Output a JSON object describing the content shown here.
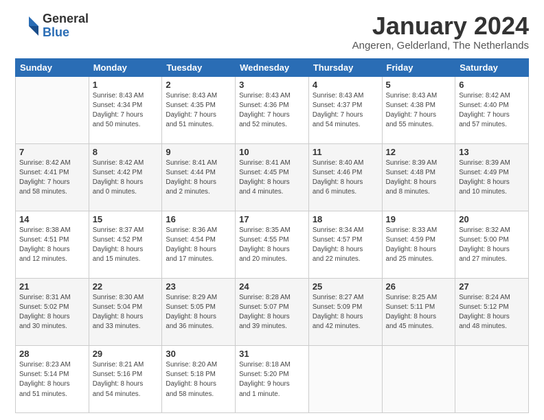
{
  "logo": {
    "general": "General",
    "blue": "Blue"
  },
  "title": "January 2024",
  "subtitle": "Angeren, Gelderland, The Netherlands",
  "days_header": [
    "Sunday",
    "Monday",
    "Tuesday",
    "Wednesday",
    "Thursday",
    "Friday",
    "Saturday"
  ],
  "weeks": [
    [
      {
        "day": "",
        "info": ""
      },
      {
        "day": "1",
        "info": "Sunrise: 8:43 AM\nSunset: 4:34 PM\nDaylight: 7 hours\nand 50 minutes."
      },
      {
        "day": "2",
        "info": "Sunrise: 8:43 AM\nSunset: 4:35 PM\nDaylight: 7 hours\nand 51 minutes."
      },
      {
        "day": "3",
        "info": "Sunrise: 8:43 AM\nSunset: 4:36 PM\nDaylight: 7 hours\nand 52 minutes."
      },
      {
        "day": "4",
        "info": "Sunrise: 8:43 AM\nSunset: 4:37 PM\nDaylight: 7 hours\nand 54 minutes."
      },
      {
        "day": "5",
        "info": "Sunrise: 8:43 AM\nSunset: 4:38 PM\nDaylight: 7 hours\nand 55 minutes."
      },
      {
        "day": "6",
        "info": "Sunrise: 8:42 AM\nSunset: 4:40 PM\nDaylight: 7 hours\nand 57 minutes."
      }
    ],
    [
      {
        "day": "7",
        "info": "Sunrise: 8:42 AM\nSunset: 4:41 PM\nDaylight: 7 hours\nand 58 minutes."
      },
      {
        "day": "8",
        "info": "Sunrise: 8:42 AM\nSunset: 4:42 PM\nDaylight: 8 hours\nand 0 minutes."
      },
      {
        "day": "9",
        "info": "Sunrise: 8:41 AM\nSunset: 4:44 PM\nDaylight: 8 hours\nand 2 minutes."
      },
      {
        "day": "10",
        "info": "Sunrise: 8:41 AM\nSunset: 4:45 PM\nDaylight: 8 hours\nand 4 minutes."
      },
      {
        "day": "11",
        "info": "Sunrise: 8:40 AM\nSunset: 4:46 PM\nDaylight: 8 hours\nand 6 minutes."
      },
      {
        "day": "12",
        "info": "Sunrise: 8:39 AM\nSunset: 4:48 PM\nDaylight: 8 hours\nand 8 minutes."
      },
      {
        "day": "13",
        "info": "Sunrise: 8:39 AM\nSunset: 4:49 PM\nDaylight: 8 hours\nand 10 minutes."
      }
    ],
    [
      {
        "day": "14",
        "info": "Sunrise: 8:38 AM\nSunset: 4:51 PM\nDaylight: 8 hours\nand 12 minutes."
      },
      {
        "day": "15",
        "info": "Sunrise: 8:37 AM\nSunset: 4:52 PM\nDaylight: 8 hours\nand 15 minutes."
      },
      {
        "day": "16",
        "info": "Sunrise: 8:36 AM\nSunset: 4:54 PM\nDaylight: 8 hours\nand 17 minutes."
      },
      {
        "day": "17",
        "info": "Sunrise: 8:35 AM\nSunset: 4:55 PM\nDaylight: 8 hours\nand 20 minutes."
      },
      {
        "day": "18",
        "info": "Sunrise: 8:34 AM\nSunset: 4:57 PM\nDaylight: 8 hours\nand 22 minutes."
      },
      {
        "day": "19",
        "info": "Sunrise: 8:33 AM\nSunset: 4:59 PM\nDaylight: 8 hours\nand 25 minutes."
      },
      {
        "day": "20",
        "info": "Sunrise: 8:32 AM\nSunset: 5:00 PM\nDaylight: 8 hours\nand 27 minutes."
      }
    ],
    [
      {
        "day": "21",
        "info": "Sunrise: 8:31 AM\nSunset: 5:02 PM\nDaylight: 8 hours\nand 30 minutes."
      },
      {
        "day": "22",
        "info": "Sunrise: 8:30 AM\nSunset: 5:04 PM\nDaylight: 8 hours\nand 33 minutes."
      },
      {
        "day": "23",
        "info": "Sunrise: 8:29 AM\nSunset: 5:05 PM\nDaylight: 8 hours\nand 36 minutes."
      },
      {
        "day": "24",
        "info": "Sunrise: 8:28 AM\nSunset: 5:07 PM\nDaylight: 8 hours\nand 39 minutes."
      },
      {
        "day": "25",
        "info": "Sunrise: 8:27 AM\nSunset: 5:09 PM\nDaylight: 8 hours\nand 42 minutes."
      },
      {
        "day": "26",
        "info": "Sunrise: 8:25 AM\nSunset: 5:11 PM\nDaylight: 8 hours\nand 45 minutes."
      },
      {
        "day": "27",
        "info": "Sunrise: 8:24 AM\nSunset: 5:12 PM\nDaylight: 8 hours\nand 48 minutes."
      }
    ],
    [
      {
        "day": "28",
        "info": "Sunrise: 8:23 AM\nSunset: 5:14 PM\nDaylight: 8 hours\nand 51 minutes."
      },
      {
        "day": "29",
        "info": "Sunrise: 8:21 AM\nSunset: 5:16 PM\nDaylight: 8 hours\nand 54 minutes."
      },
      {
        "day": "30",
        "info": "Sunrise: 8:20 AM\nSunset: 5:18 PM\nDaylight: 8 hours\nand 58 minutes."
      },
      {
        "day": "31",
        "info": "Sunrise: 8:18 AM\nSunset: 5:20 PM\nDaylight: 9 hours\nand 1 minute."
      },
      {
        "day": "",
        "info": ""
      },
      {
        "day": "",
        "info": ""
      },
      {
        "day": "",
        "info": ""
      }
    ]
  ]
}
